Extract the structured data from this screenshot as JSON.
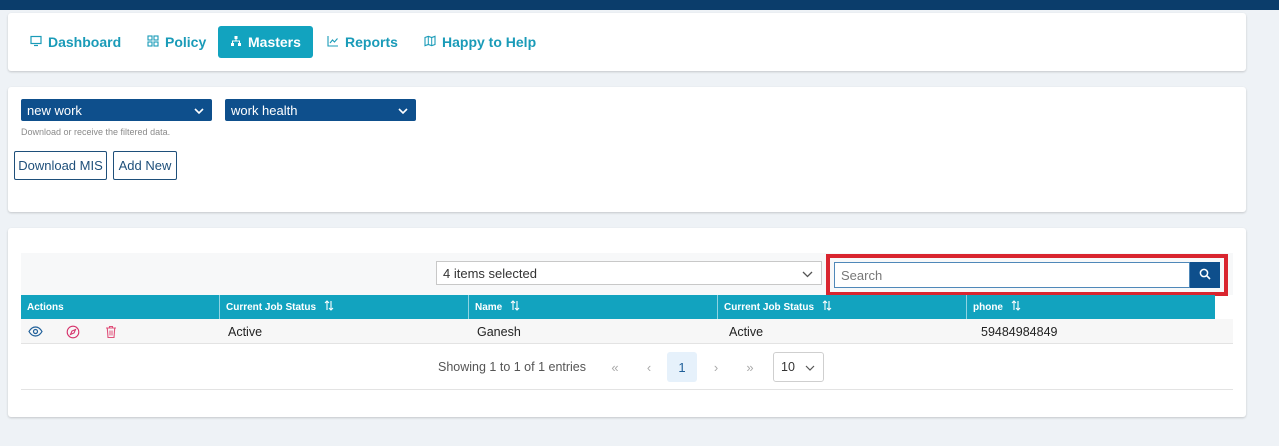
{
  "nav": {
    "items": [
      {
        "label": "Dashboard",
        "icon": "monitor-icon"
      },
      {
        "label": "Policy",
        "icon": "grid-icon"
      },
      {
        "label": "Masters",
        "icon": "sitemap-icon",
        "active": true
      },
      {
        "label": "Reports",
        "icon": "line-chart-icon"
      },
      {
        "label": "Happy to Help",
        "icon": "map-icon"
      }
    ]
  },
  "filters": {
    "dropdown1": "new work",
    "dropdown2": "work health",
    "hint": "Download or receive the filtered data.",
    "download_label": "Download MIS",
    "add_label": "Add New"
  },
  "table": {
    "column_select": "4 items selected",
    "search_placeholder": "Search",
    "headers": [
      "Actions",
      "Current Job Status",
      "Name",
      "Current Job Status",
      "phone"
    ],
    "rows": [
      {
        "status": "Active",
        "name": "Ganesh",
        "status2": "Active",
        "phone": "59484984849"
      }
    ],
    "pagination": {
      "info": "Showing 1 to 1 of 1 entries",
      "first": "«",
      "prev": "‹",
      "current": "1",
      "next": "›",
      "last": "»",
      "rows_per_page": "10"
    }
  },
  "colors": {
    "topbar": "#0b3d6b",
    "accent": "#12a3bf",
    "dropdown": "#0e4f8c",
    "highlight": "#d9252f",
    "action_view": "#1f5f99",
    "action_edit": "#d6336c",
    "action_delete": "#e0507a"
  }
}
